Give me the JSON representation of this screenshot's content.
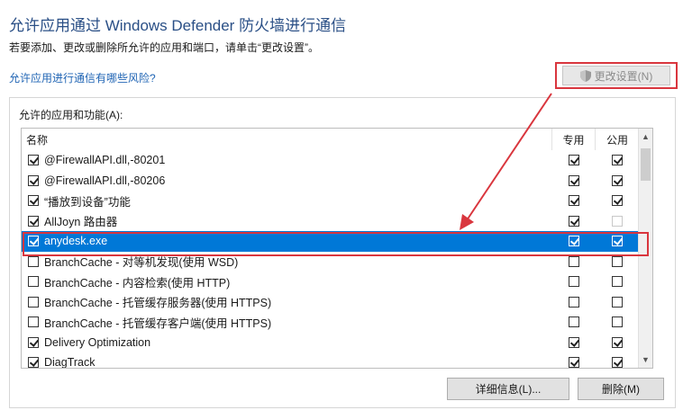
{
  "header": {
    "title": "允许应用通过 Windows Defender 防火墙进行通信",
    "subtitle": "若要添加、更改或删除所允许的应用和端口，请单击“更改设置”。",
    "risk_link": "允许应用进行通信有哪些风险?"
  },
  "change_settings": {
    "label": "更改设置(N)"
  },
  "apps_group": {
    "label": "允许的应用和功能(A):",
    "columns": {
      "name": "名称",
      "private": "专用",
      "public": "公用"
    },
    "rows": [
      {
        "name": "@FirewallAPI.dll,-80201",
        "enabled": true,
        "private": true,
        "public": true
      },
      {
        "name": "@FirewallAPI.dll,-80206",
        "enabled": true,
        "private": true,
        "public": true
      },
      {
        "name": "“播放到设备”功能",
        "enabled": true,
        "private": true,
        "public": true
      },
      {
        "name": "AllJoyn 路由器",
        "enabled": true,
        "private": true,
        "public": false
      },
      {
        "name": "anydesk.exe",
        "enabled": true,
        "private": true,
        "public": true,
        "selected": true
      },
      {
        "name": "BranchCache - 对等机发现(使用 WSD)",
        "enabled": false,
        "private": false,
        "public": false
      },
      {
        "name": "BranchCache - 内容检索(使用 HTTP)",
        "enabled": false,
        "private": false,
        "public": false
      },
      {
        "name": "BranchCache - 托管缓存服务器(使用 HTTPS)",
        "enabled": false,
        "private": false,
        "public": false
      },
      {
        "name": "BranchCache - 托管缓存客户端(使用 HTTPS)",
        "enabled": false,
        "private": false,
        "public": false
      },
      {
        "name": "Delivery Optimization",
        "enabled": true,
        "private": true,
        "public": true
      },
      {
        "name": "DiagTrack",
        "enabled": true,
        "private": true,
        "public": true
      }
    ]
  },
  "buttons": {
    "details": "详细信息(L)...",
    "remove": "删除(M)"
  },
  "colors": {
    "accent": "#0078d7",
    "highlight": "#d9363e",
    "title": "#2a4f86",
    "link": "#1f64b4"
  }
}
